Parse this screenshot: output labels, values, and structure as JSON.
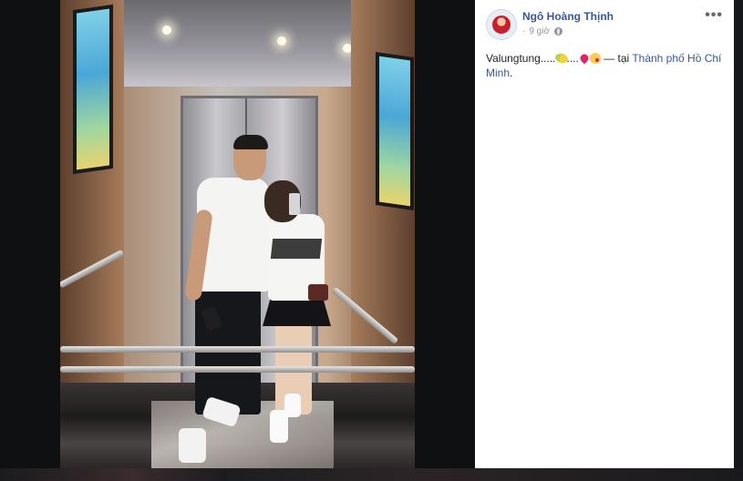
{
  "post": {
    "author": "Ngô Hoàng Thịnh",
    "time": "9 giờ",
    "privacy_icon": "globe-icon",
    "more_label": "•••",
    "caption_prefix": "Valungtung.....",
    "caption_mid": "....",
    "caption_emojis": [
      "corn-emoji",
      "heart-emoji",
      "kiss-emoji"
    ],
    "at_label": " — tại ",
    "location": "Thành phố Hồ Chí Minh",
    "trailing": "."
  },
  "colors": {
    "link": "#365899",
    "meta": "#90949c",
    "panel_bg": "#ffffff",
    "backdrop": "#0f1012"
  }
}
